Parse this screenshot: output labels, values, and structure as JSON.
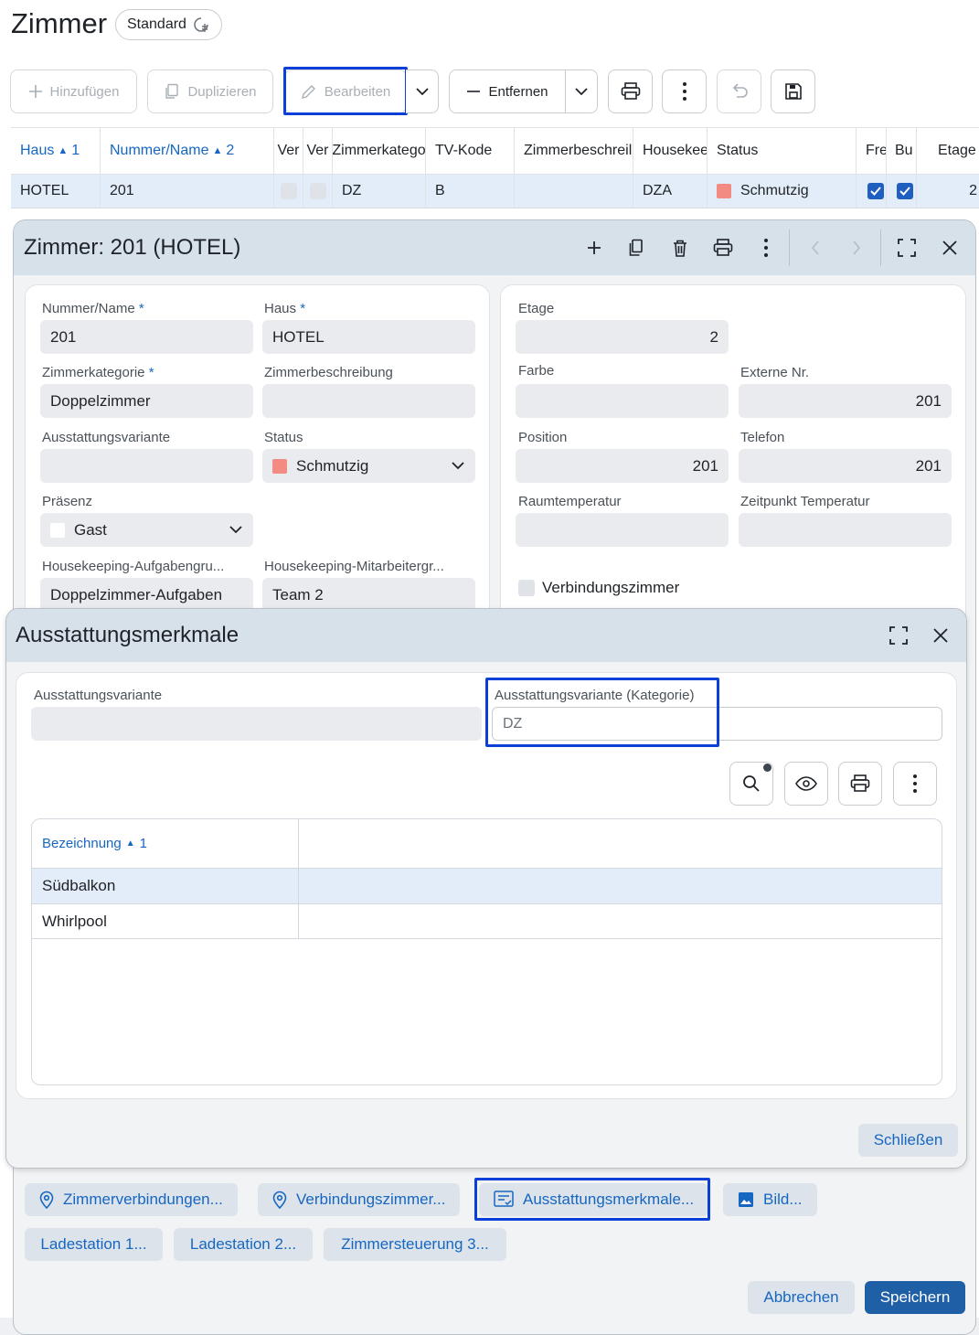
{
  "page": {
    "title": "Zimmer",
    "view_badge": "Standard"
  },
  "toolbar": {
    "add": "Hinzufügen",
    "duplicate": "Duplizieren",
    "edit": "Bearbeiten",
    "remove": "Entfernen"
  },
  "grid": {
    "headers": [
      "Haus",
      "1",
      "Nummer/Name",
      "2",
      "Ver",
      "Ver",
      "Zimmerkatego",
      "TV-Kode",
      "Zimmerbeschreil",
      "Housekee",
      "Status",
      "Fre",
      "Bu",
      "Etage"
    ],
    "row": {
      "haus": "HOTEL",
      "nummer": "201",
      "kategorie": "DZ",
      "tv": "B",
      "housekeeping": "DZA",
      "status": "Schmutzig",
      "status_color": "#f28b82",
      "etage": "2"
    }
  },
  "dialog1": {
    "title": "Zimmer: 201 (HOTEL)",
    "fields": {
      "nummer_label": "Nummer/Name",
      "nummer": "201",
      "haus_label": "Haus",
      "haus": "HOTEL",
      "kategorie_label": "Zimmerkategorie",
      "kategorie": "Doppelzimmer",
      "beschreibung_label": "Zimmerbeschreibung",
      "beschreibung": "",
      "ausstattung_label": "Ausstattungsvariante",
      "ausstattung": "",
      "status_label": "Status",
      "status": "Schmutzig",
      "praesenz_label": "Präsenz",
      "praesenz": "Gast",
      "hk_aufgaben_label": "Housekeeping-Aufgabengru...",
      "hk_aufgaben": "Doppelzimmer-Aufgaben",
      "hk_mitarbeiter_label": "Housekeeping-Mitarbeitergr...",
      "hk_mitarbeiter": "Team 2",
      "etage_label": "Etage",
      "etage": "2",
      "farbe_label": "Farbe",
      "externe_label": "Externe Nr.",
      "externe": "201",
      "position_label": "Position",
      "position": "201",
      "telefon_label": "Telefon",
      "telefon": "201",
      "raumtemp_label": "Raumtemperatur",
      "zeitpunkt_label": "Zeitpunkt Temperatur",
      "verbindung_label": "Verbindungszimmer"
    },
    "required_mark": "*",
    "chips": [
      "Zimmerverbindungen...",
      "Verbindungszimmer...",
      "Ausstattungsmerkmale...",
      "Bild...",
      "Ladestation 1...",
      "Ladestation 2...",
      "Zimmersteuerung 3..."
    ],
    "cancel": "Abbrechen",
    "save": "Speichern"
  },
  "dialog2": {
    "title": "Ausstattungsmerkmale",
    "variant_label": "Ausstattungsvariante",
    "variant_value": "",
    "variant_cat_label": "Ausstattungsvariante (Kategorie)",
    "variant_cat_value": "DZ",
    "table_header": "Bezeichnung",
    "table_sort": "1",
    "rows": [
      "Südbalkon",
      "Whirlpool"
    ],
    "close": "Schließen"
  }
}
